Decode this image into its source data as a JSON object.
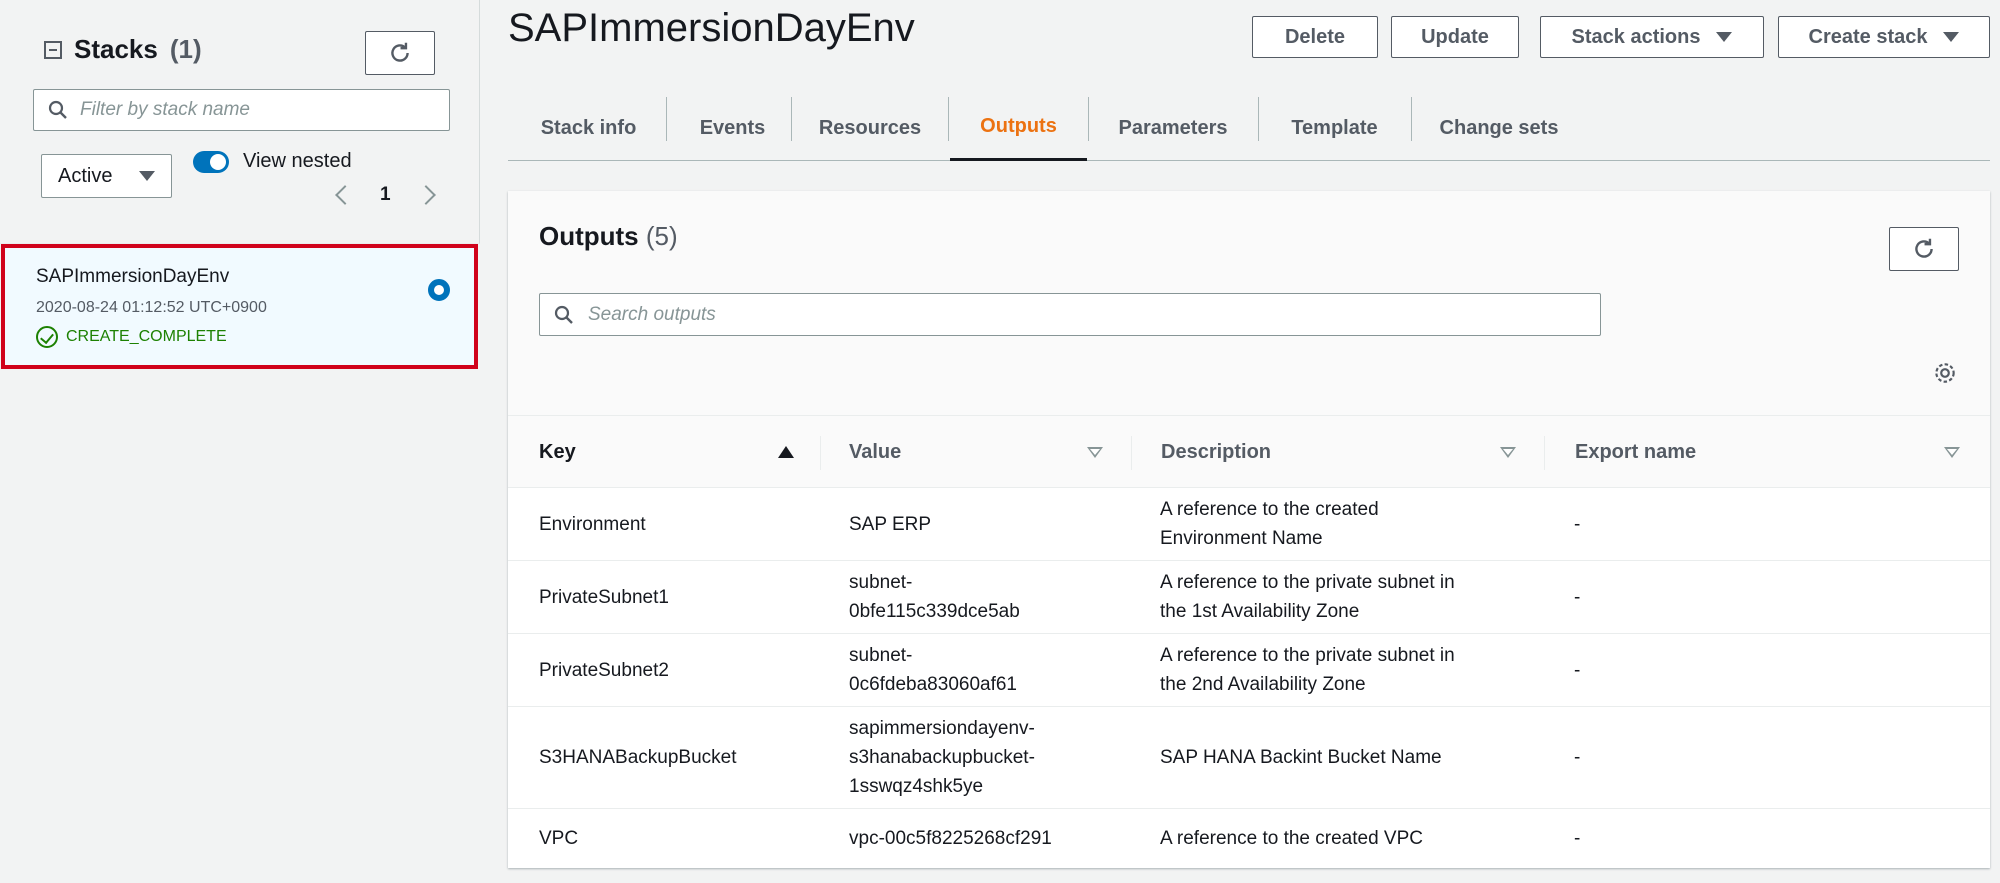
{
  "sidebar": {
    "title": "Stacks",
    "count": "(1)",
    "filter_placeholder": "Filter by stack name",
    "status_filter": "Active",
    "view_nested_label": "View nested",
    "page": "1",
    "stack": {
      "name": "SAPImmersionDayEnv",
      "date": "2020-08-24 01:12:52 UTC+0900",
      "status": "CREATE_COMPLETE"
    }
  },
  "header": {
    "title": "SAPImmersionDayEnv",
    "buttons": {
      "delete": "Delete",
      "update": "Update",
      "stack_actions": "Stack actions",
      "create_stack": "Create stack"
    }
  },
  "tabs": [
    "Stack info",
    "Events",
    "Resources",
    "Outputs",
    "Parameters",
    "Template",
    "Change sets"
  ],
  "active_tab": "Outputs",
  "outputs": {
    "title": "Outputs",
    "count": "(5)",
    "search_placeholder": "Search outputs",
    "columns": [
      "Key",
      "Value",
      "Description",
      "Export name"
    ],
    "rows": [
      {
        "key": "Environment",
        "value": "SAP ERP",
        "description": "A reference to the created\nEnvironment Name",
        "export": "-"
      },
      {
        "key": "PrivateSubnet1",
        "value": "subnet-\n0bfe115c339dce5ab",
        "description": "A reference to the private subnet in\nthe 1st Availability Zone",
        "export": "-"
      },
      {
        "key": "PrivateSubnet2",
        "value": "subnet-\n0c6fdeba83060af61",
        "description": "A reference to the private subnet in\nthe 2nd Availability Zone",
        "export": "-"
      },
      {
        "key": "S3HANABackupBucket",
        "value": "sapimmersiondayenv-\ns3hanabackupbucket-\n1sswqz4shk5ye",
        "description": "SAP HANA Backint Bucket Name",
        "export": "-"
      },
      {
        "key": "VPC",
        "value": "vpc-00c5f8225268cf291",
        "description": "A reference to the created VPC",
        "export": "-"
      }
    ]
  },
  "colors": {
    "accent": "#ec7211",
    "selected_border": "#d0021b",
    "success": "#1d8102",
    "toggle": "#0073bb"
  }
}
